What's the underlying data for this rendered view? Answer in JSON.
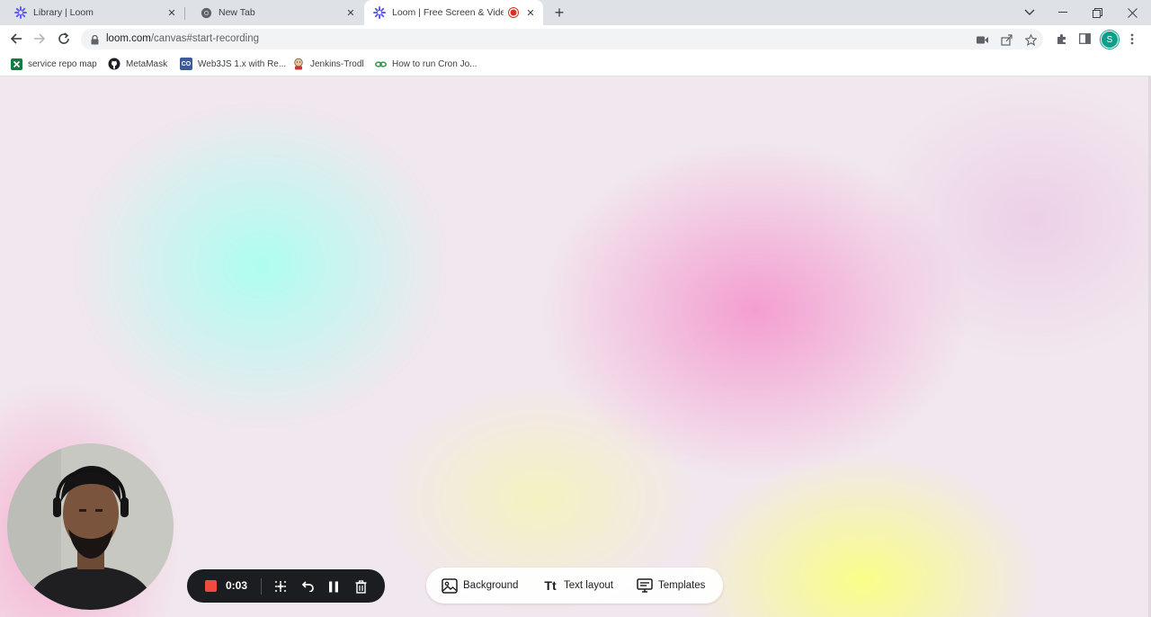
{
  "tabs": [
    {
      "title": "Library | Loom",
      "icon": "loom-icon"
    },
    {
      "title": "New Tab",
      "icon": "chrome-icon"
    },
    {
      "title": "Loom | Free Screen & Video",
      "icon": "loom-icon",
      "recording": true,
      "active": true
    }
  ],
  "address_bar": {
    "url_host": "loom.com",
    "url_path": "/canvas#start-recording"
  },
  "profile": {
    "initial": "S",
    "color": "#0d9f8a"
  },
  "bookmarks": [
    {
      "label": "service repo map",
      "icon": "excel-icon"
    },
    {
      "label": "MetaMask",
      "icon": "github-icon"
    },
    {
      "label": "Web3JS 1.x with Re...",
      "icon": "co-icon"
    },
    {
      "label": "Jenkins-Trodl",
      "icon": "jenkins-icon"
    },
    {
      "label": "How to run Cron Jo...",
      "icon": "link-icon"
    }
  ],
  "recording_controls": {
    "timer": "0:03",
    "stop_color": "#f04b3c"
  },
  "canvas_options": {
    "background_label": "Background",
    "text_layout_label": "Text layout",
    "text_layout_icon_text": "Tt",
    "templates_label": "Templates"
  }
}
